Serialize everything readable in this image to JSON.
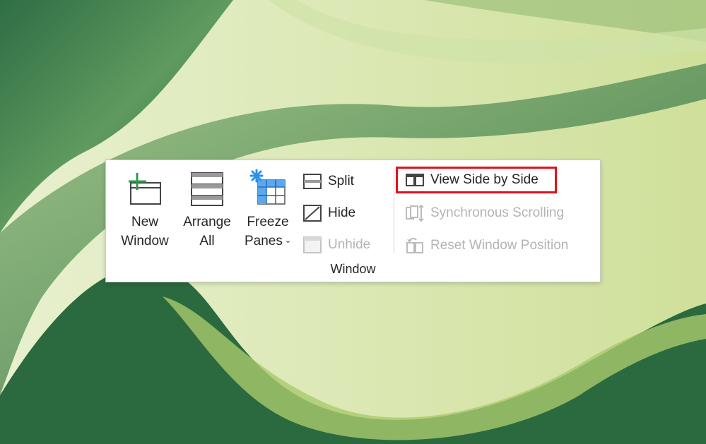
{
  "ribbon": {
    "group_label": "Window",
    "new_window": {
      "line1": "New",
      "line2": "Window",
      "icon": "new-window-icon"
    },
    "arrange_all": {
      "line1": "Arrange",
      "line2": "All",
      "icon": "arrange-all-icon"
    },
    "freeze_panes": {
      "line1": "Freeze",
      "line2": "Panes",
      "chevron": "⌄",
      "icon": "freeze-panes-icon"
    },
    "split": {
      "label": "Split",
      "icon": "split-icon",
      "enabled": true
    },
    "hide": {
      "label": "Hide",
      "icon": "hide-icon",
      "enabled": true
    },
    "unhide": {
      "label": "Unhide",
      "icon": "unhide-icon",
      "enabled": false
    },
    "view_side_by_side": {
      "label": "View Side by Side",
      "icon": "view-side-by-side-icon",
      "enabled": true,
      "highlighted": true
    },
    "synchronous_scrolling": {
      "label": "Synchronous Scrolling",
      "icon": "synchronous-scrolling-icon",
      "enabled": false
    },
    "reset_window_position": {
      "label": "Reset Window Position",
      "icon": "reset-window-position-icon",
      "enabled": false
    }
  },
  "colors": {
    "highlight_border": "#e3101e",
    "accent_green": "#2e9a4b",
    "accent_blue": "#2f8fe8",
    "disabled_text": "#b4b4b4"
  }
}
